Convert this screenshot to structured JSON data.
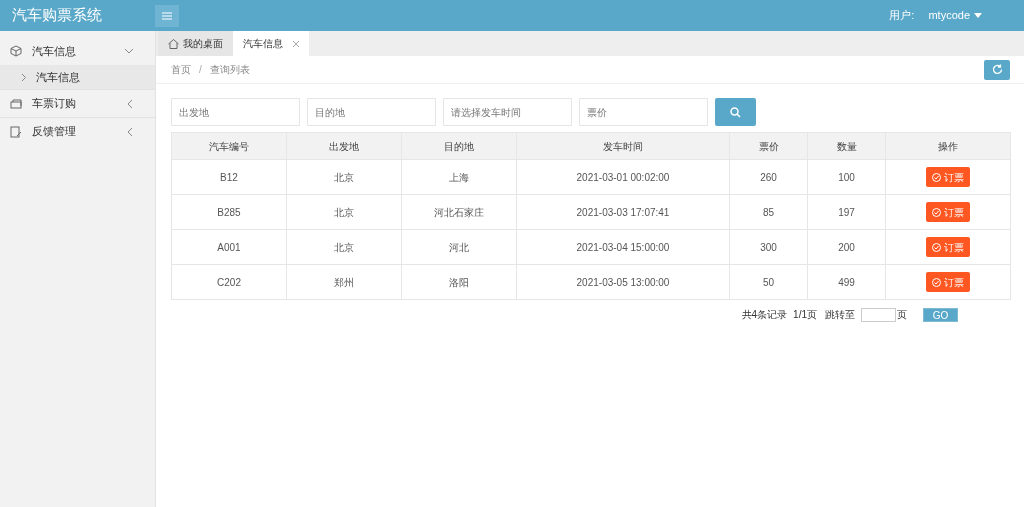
{
  "header": {
    "title": "汽车购票系统",
    "user_label": "用户:",
    "username": "mtycode"
  },
  "sidebar": {
    "items": [
      {
        "label": "汽车信息",
        "expanded": true,
        "children": [
          {
            "label": "汽车信息",
            "selected": true
          }
        ]
      },
      {
        "label": "车票订购",
        "expanded": false
      },
      {
        "label": "反馈管理",
        "expanded": false
      }
    ]
  },
  "tabs": [
    {
      "label": "我的桌面",
      "kind": "home",
      "selected": false
    },
    {
      "label": "汽车信息",
      "kind": "closable",
      "selected": true
    }
  ],
  "breadcrumb": [
    "首页",
    "查询列表"
  ],
  "breadcrumb_separator": "/",
  "search": {
    "fields": [
      {
        "placeholder": "出发地"
      },
      {
        "placeholder": "目的地"
      },
      {
        "placeholder": "请选择发车时间"
      },
      {
        "placeholder": "票价"
      }
    ]
  },
  "table": {
    "columns": [
      "汽车编号",
      "出发地",
      "目的地",
      "发车时间",
      "票价",
      "数量",
      "操作"
    ],
    "rows": [
      {
        "cells": [
          "B12",
          "北京",
          "上海",
          "2021-03-01 00:02:00",
          "260",
          "100"
        ],
        "action": "订票"
      },
      {
        "cells": [
          "B285",
          "北京",
          "河北石家庄",
          "2021-03-03 17:07:41",
          "85",
          "197"
        ],
        "action": "订票"
      },
      {
        "cells": [
          "A001",
          "北京",
          "河北",
          "2021-03-04 15:00:00",
          "300",
          "200"
        ],
        "action": "订票"
      },
      {
        "cells": [
          "C202",
          "郑州",
          "洛阳",
          "2021-03-05 13:00:00",
          "50",
          "499"
        ],
        "action": "订票"
      }
    ]
  },
  "pagination": {
    "total": "共4条记录",
    "pages": "1/1页",
    "jump_label": "跳转至",
    "page_unit": "页",
    "go": "GO"
  }
}
